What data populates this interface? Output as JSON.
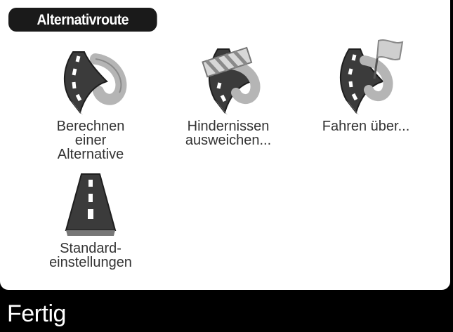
{
  "header": {
    "title": "Alternativroute"
  },
  "menu": {
    "items": [
      {
        "id": "calc",
        "label_lines": [
          "Berechnen",
          "einer",
          "Alternative"
        ],
        "icon": "road-alternative-icon"
      },
      {
        "id": "avoid",
        "label_lines": [
          "Hindernissen",
          "ausweichen..."
        ],
        "icon": "road-blocked-icon"
      },
      {
        "id": "via",
        "label_lines": [
          "Fahren über..."
        ],
        "icon": "road-flag-icon"
      },
      {
        "id": "default",
        "label_lines": [
          "Standard-",
          "einstellungen"
        ],
        "icon": "straight-road-icon"
      }
    ]
  },
  "footer": {
    "done_label": "Fertig"
  },
  "colors": {
    "background": "#000000",
    "panel": "#ffffff",
    "road": "#3a3a3a",
    "road_lane": "#ffffff",
    "road_edge": "#888888"
  }
}
